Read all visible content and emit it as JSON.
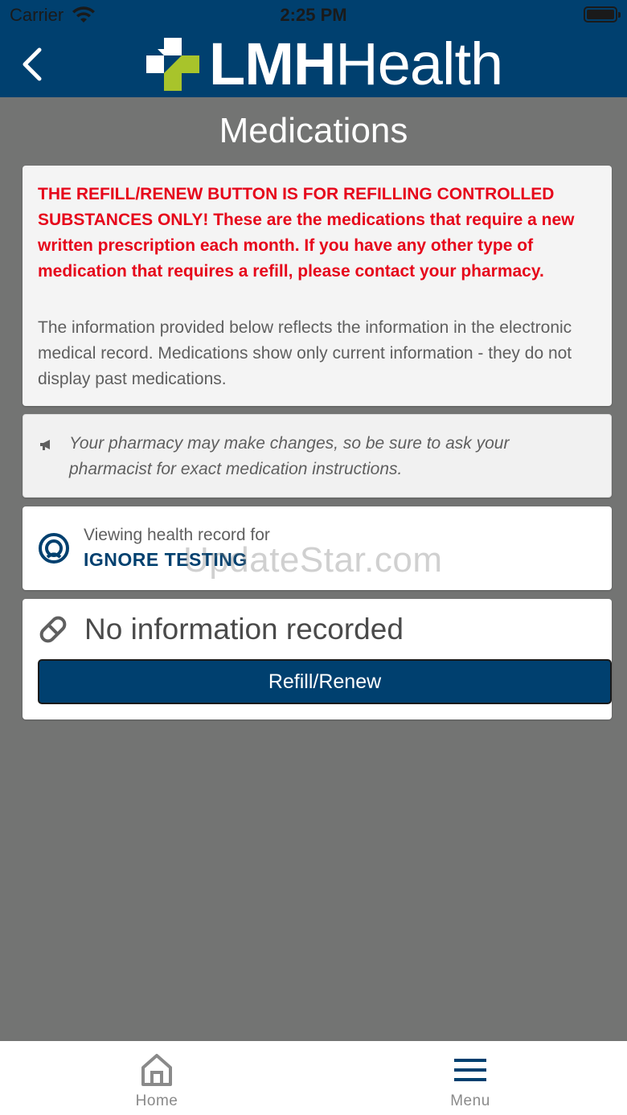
{
  "status_bar": {
    "carrier": "Carrier",
    "time": "2:25 PM"
  },
  "header": {
    "logo_bold": "LMH",
    "logo_regular": "Health"
  },
  "page": {
    "title": "Medications"
  },
  "warning": {
    "text": "THE REFILL/RENEW BUTTON IS FOR REFILLING CONTROLLED SUBSTANCES ONLY!  These are the medications that require a new written prescription each month.  If you have any other type of medication that requires a refill, please contact your pharmacy.",
    "info": "The information provided below reflects the information in the electronic medical record. Medications show only current information - they do not display past medications."
  },
  "note": {
    "text": "Your pharmacy may make changes, so be sure to ask your pharmacist for exact medication instructions."
  },
  "record": {
    "label": "Viewing health record for",
    "name": "IGNORE TESTING"
  },
  "watermark": "UpdateStar.com",
  "medications": {
    "empty_text": "No information recorded",
    "refill_label": "Refill/Renew"
  },
  "tabbar": {
    "home_label": "Home",
    "menu_label": "Menu"
  },
  "colors": {
    "brand": "#00406f",
    "warning": "#e6071b",
    "logo_green": "#a8c42b",
    "background": "#737473"
  }
}
